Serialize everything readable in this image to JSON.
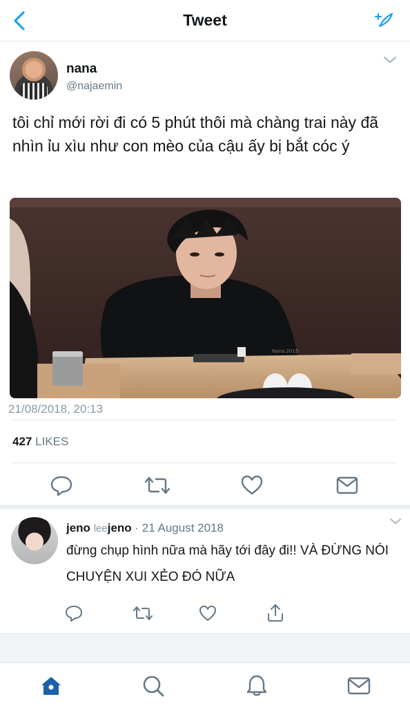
{
  "header": {
    "title": "Tweet"
  },
  "tweet": {
    "name": "nana",
    "handle": "@najaemin",
    "text": "tôi chỉ mới rời đi có 5 phút thôi mà chàng trai này đã nhìn ỉu xìu như con mèo của cậu ấy bị bắt cóc ý",
    "timestamp": "21/08/2018, 20:13",
    "likes_count": "427",
    "likes_label": "LIKES",
    "photo_watermark": "Nana.2015"
  },
  "reply": {
    "name": "jeno",
    "handle_prefix": "lee",
    "handle_suffix": "jeno",
    "date": "· 21 August 2018",
    "text": "đừng chụp hình nữa mà hãy tới đây đi!! VÀ ĐỪNG NÓI CHUYỆN XUI XẺO ĐÓ NỮA"
  },
  "icons": {
    "back": "chevron-left-icon",
    "compose": "sparkle-compose-icon",
    "reply": "reply-icon",
    "retweet": "retweet-icon",
    "like": "heart-icon",
    "dm": "envelope-icon",
    "share": "share-icon",
    "home": "home-icon",
    "search": "search-icon",
    "notifications": "bell-icon",
    "messages": "envelope-icon"
  },
  "colors": {
    "accent": "#1da1f2",
    "nav_active": "#1d5fa8",
    "action_gray": "#657786",
    "text": "#14171a"
  }
}
